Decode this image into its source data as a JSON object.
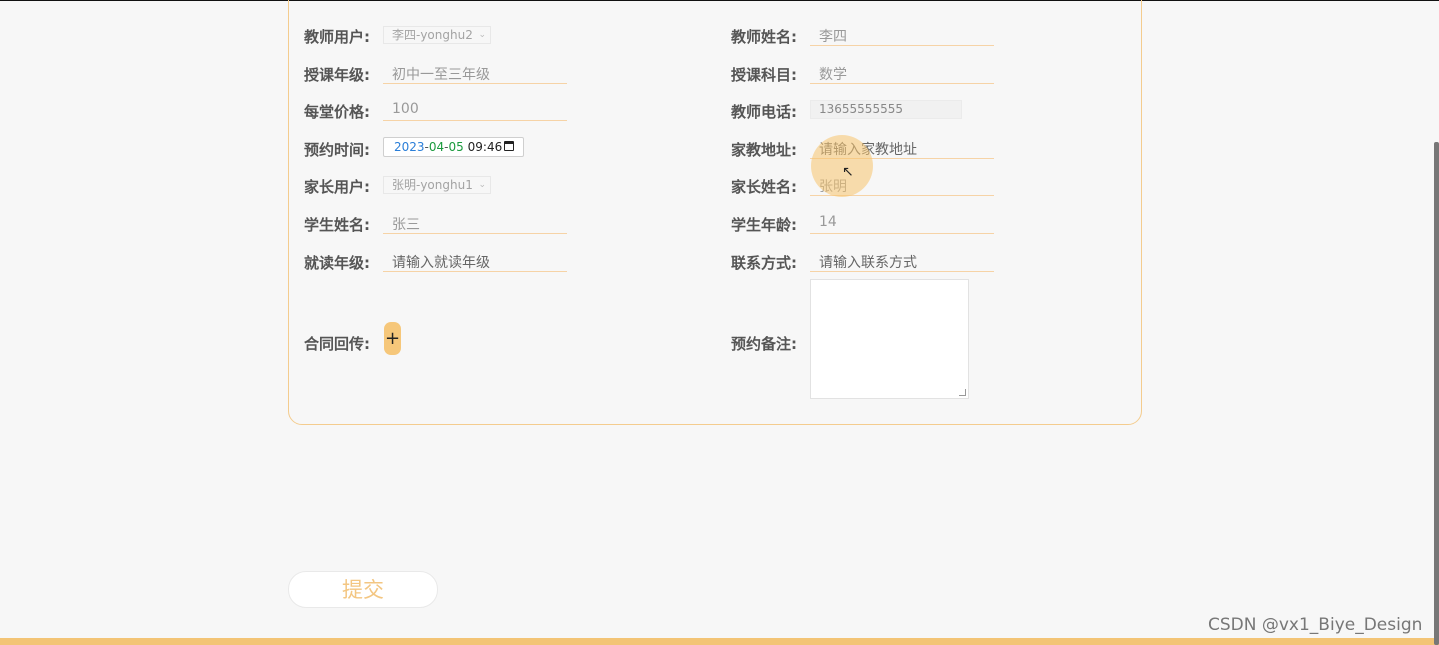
{
  "form": {
    "teacher_user": {
      "label": "教师用户:",
      "value": "李四-yonghu2"
    },
    "teacher_name": {
      "label": "教师姓名:",
      "value": "李四"
    },
    "grade": {
      "label": "授课年级:",
      "value": "初中一至三年级"
    },
    "subject": {
      "label": "授课科目:",
      "value": "数学"
    },
    "price": {
      "label": "每堂价格:",
      "value": "100"
    },
    "teacher_phone": {
      "label": "教师电话:",
      "value": "13655555555"
    },
    "book_time": {
      "label": "预约时间:",
      "year": "2023",
      "sep1": "-",
      "month": "04",
      "sep2": "-",
      "day": "05",
      "time": "09:46"
    },
    "address": {
      "label": "家教地址:",
      "placeholder": "请输入家教地址"
    },
    "parent_user": {
      "label": "家长用户:",
      "value": "张明-yonghu1"
    },
    "parent_name": {
      "label": "家长姓名:",
      "value": "张明"
    },
    "student_name": {
      "label": "学生姓名:",
      "value": "张三"
    },
    "student_age": {
      "label": "学生年龄:",
      "value": "14"
    },
    "study_grade": {
      "label": "就读年级:",
      "placeholder": "请输入就读年级"
    },
    "contact": {
      "label": "联系方式:",
      "placeholder": "请输入联系方式"
    },
    "contract": {
      "label": "合同回传:",
      "upload_label": "+"
    },
    "remark": {
      "label": "预约备注:"
    }
  },
  "submit_label": "提交",
  "watermark": "CSDN @vx1_Biye_Design",
  "colors": {
    "accent": "#f3c475",
    "border": "#f4cc8e"
  }
}
